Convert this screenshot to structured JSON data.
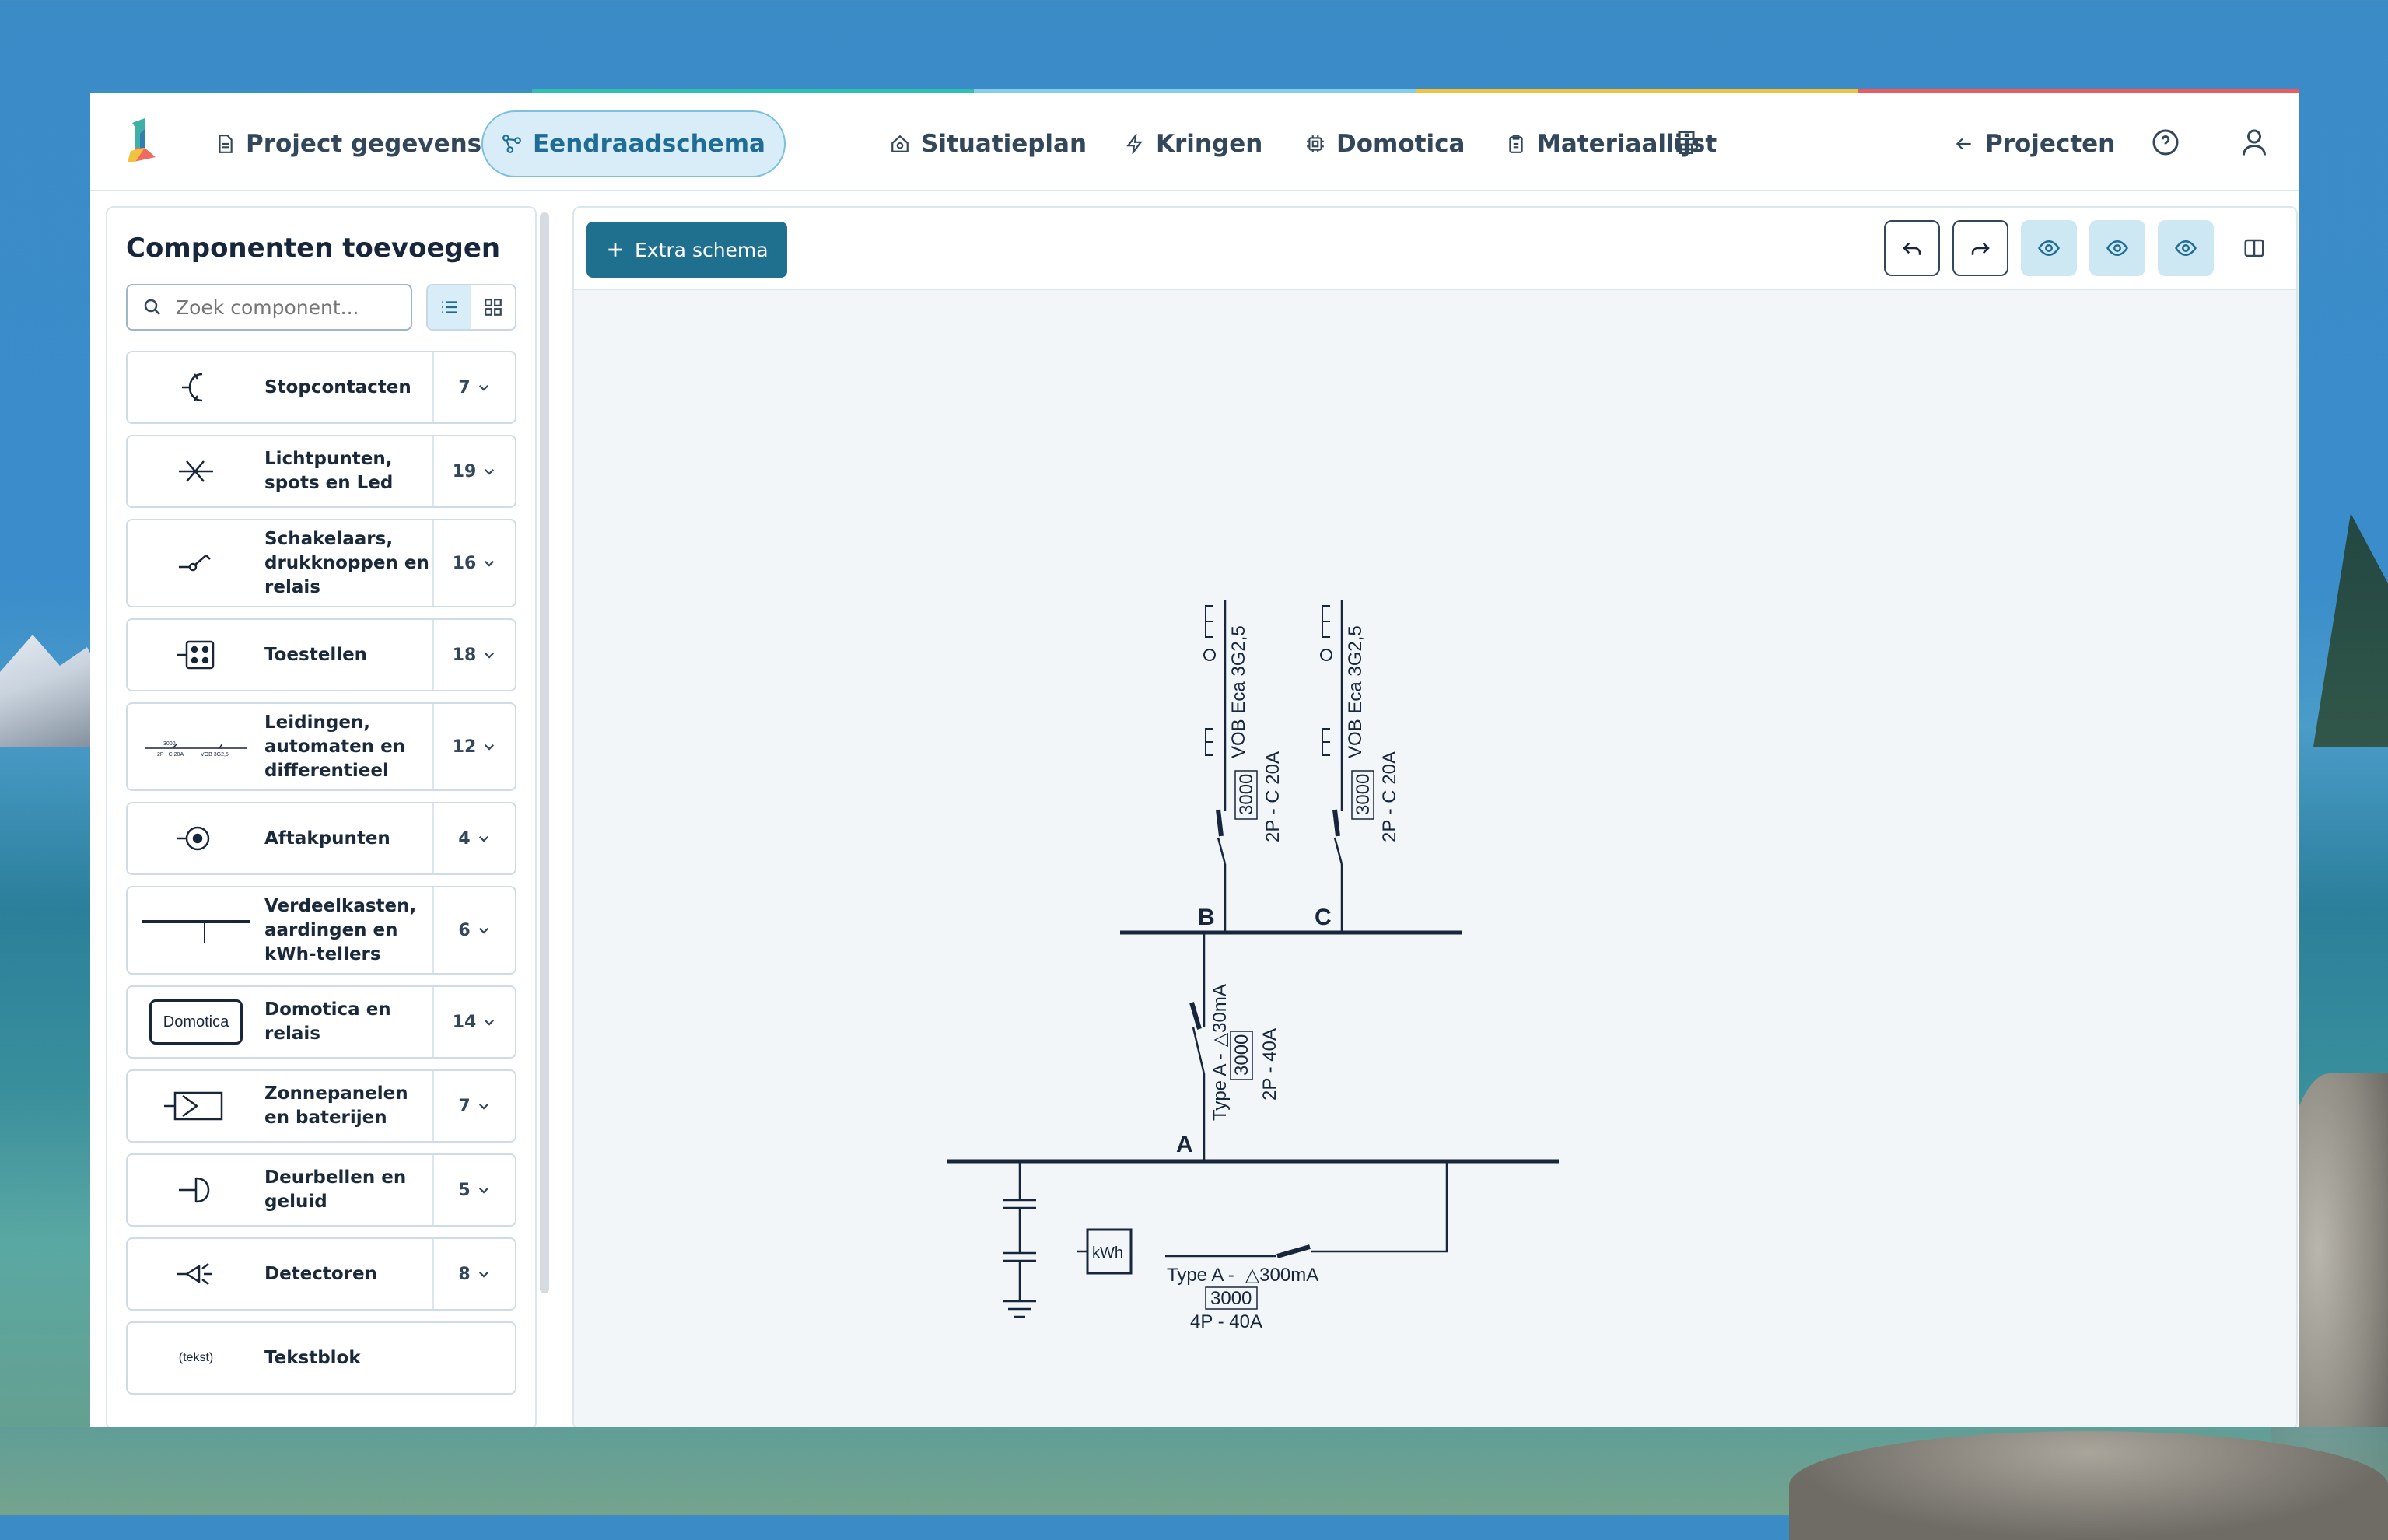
{
  "nav": {
    "tabs": [
      {
        "label": "Project gegevens",
        "icon": "document-icon"
      },
      {
        "label": "Eendraadschema",
        "icon": "diagram-icon",
        "active": true
      },
      {
        "label": "Situatieplan",
        "icon": "house-icon"
      },
      {
        "label": "Kringen",
        "icon": "lightning-icon"
      },
      {
        "label": "Domotica",
        "icon": "chip-icon"
      },
      {
        "label": "Materiaallijst",
        "icon": "clipboard-icon"
      }
    ],
    "projects_label": "Projecten"
  },
  "sidebar": {
    "title": "Componenten toevoegen",
    "search_placeholder": "Zoek component...",
    "categories": [
      {
        "label": "Stopcontacten",
        "count": "7"
      },
      {
        "label": "Lichtpunten, spots en Led",
        "count": "19"
      },
      {
        "label": "Schakelaars, drukknoppen en relais",
        "count": "16"
      },
      {
        "label": "Toestellen",
        "count": "18"
      },
      {
        "label": "Leidingen, automaten en differentieel",
        "count": "12"
      },
      {
        "label": "Aftakpunten",
        "count": "4"
      },
      {
        "label": "Verdeelkasten, aardingen en kWh-tellers",
        "count": "6"
      },
      {
        "label": "Domotica en relais",
        "count": "14",
        "icon_text": "Domotica"
      },
      {
        "label": "Zonnepanelen en baterijen",
        "count": "7"
      },
      {
        "label": "Deurbellen en geluid",
        "count": "5"
      },
      {
        "label": "Detectoren",
        "count": "8"
      },
      {
        "label": "Tekstblok",
        "count": "",
        "icon_text": "(tekst)"
      }
    ],
    "leiding_icon_texts": [
      "3000",
      "2P - C 20A",
      "VOB 3G2,5"
    ]
  },
  "toolbar": {
    "extra_schema_label": "Extra schema"
  },
  "schema": {
    "bus_labels": {
      "a": "A",
      "b": "B",
      "c": "C"
    },
    "cable_label": "VOB Eca 3G2,5",
    "breaker_b": {
      "value": "3000",
      "spec": "2P - C 20A"
    },
    "breaker_c": {
      "value": "3000",
      "spec": "2P - C 20A"
    },
    "differential": {
      "type": "Type A -",
      "sens": "△30mA",
      "value": "3000",
      "spec": "2P - 40A"
    },
    "main_switch": {
      "type": "Type A -",
      "sens": "△300mA",
      "value": "3000",
      "spec": "4P - 40A"
    },
    "meter_label": "kWh"
  }
}
